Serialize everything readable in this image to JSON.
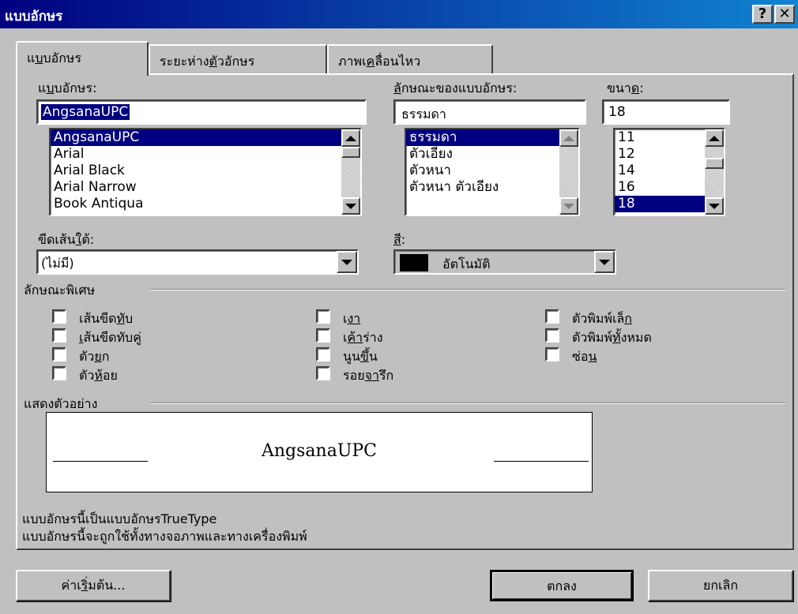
{
  "window": {
    "title": "แบบอักษร",
    "help_label": "?",
    "close_label": "✕"
  },
  "tabs": [
    {
      "label_pre": "แ",
      "label_u": "บ",
      "label_post": "บอักษร"
    },
    {
      "label_pre": "ระยะห่าง",
      "label_u": "ตั",
      "label_post": "วอักษร"
    },
    {
      "label_pre": "ภาพเ",
      "label_u": "ค",
      "label_post": "ลื่อนไหว"
    }
  ],
  "font": {
    "label_pre": "แ",
    "label_u": "บ",
    "label_post": "บอักษร:",
    "value": "AngsanaUPC",
    "items": [
      "AngsanaUPC",
      "Arial",
      "Arial Black",
      "Arial Narrow",
      "Book Antiqua"
    ],
    "selected_index": 0
  },
  "style": {
    "label_pre": "",
    "label_u": "ลั",
    "label_post": "กษณะของแบบอักษร:",
    "value": "ธรรมดา",
    "items": [
      "ธรรมดา",
      "ตัวเอียง",
      "ตัวหนา",
      "ตัวหนา ตัวเอียง"
    ],
    "selected_index": 0
  },
  "size": {
    "label_pre": "ขนา",
    "label_u": "ด",
    "label_post": ":",
    "value": "18",
    "items": [
      "11",
      "12",
      "14",
      "16",
      "18"
    ],
    "selected_index": 4
  },
  "underline": {
    "label_pre": "ขีดเส้น",
    "label_u": "ใ",
    "label_post": "ต้:",
    "value": "(ไม่มี)"
  },
  "color": {
    "label_pre": "",
    "label_u": "สี",
    "label_post": ":",
    "value": "อัตโนมัติ",
    "swatch": "#000000"
  },
  "effects": {
    "title": "ลักษณะพิเศษ",
    "col1": [
      {
        "pre": "เส้นขีด",
        "u": "ทั",
        "post": "บ"
      },
      {
        "pre": "",
        "u": "เ",
        "post": "ส้นขีดทับคู่"
      },
      {
        "pre": "ตัว",
        "u": "ย",
        "post": "ก"
      },
      {
        "pre": "ตัว",
        "u": "ห้",
        "post": "อย"
      }
    ],
    "col2": [
      {
        "pre": "เ",
        "u": "งา",
        "post": ""
      },
      {
        "pre": "เ",
        "u": "ค้า",
        "post": "ร่าง"
      },
      {
        "pre": "นูน",
        "u": "ขึ้",
        "post": "น"
      },
      {
        "pre": "รอย",
        "u": "จา",
        "post": "รึก"
      }
    ],
    "col3": [
      {
        "pre": "ตัวพิมพ์เล็",
        "u": "ก",
        "post": ""
      },
      {
        "pre": "ตัวพิมพ์",
        "u": "ทั้",
        "post": "งหมด"
      },
      {
        "pre": "ซ่อ",
        "u": "น",
        "post": ""
      }
    ]
  },
  "preview": {
    "title": "แสดงตัวอย่าง",
    "text": "AngsanaUPC"
  },
  "info": {
    "line1": "แบบอักษรนี้เป็นแบบอักษรTrueType",
    "line2": "แบบอักษรนี้จะถูกใช้ทั้งทางจอภาพและทางเครื่องพิมพ์"
  },
  "buttons": {
    "default_pre": "ค่าเ",
    "default_u": "ริ่",
    "default_post": "มต้น...",
    "ok_label": "ตกลง",
    "cancel_label": "ยกเลิก"
  }
}
